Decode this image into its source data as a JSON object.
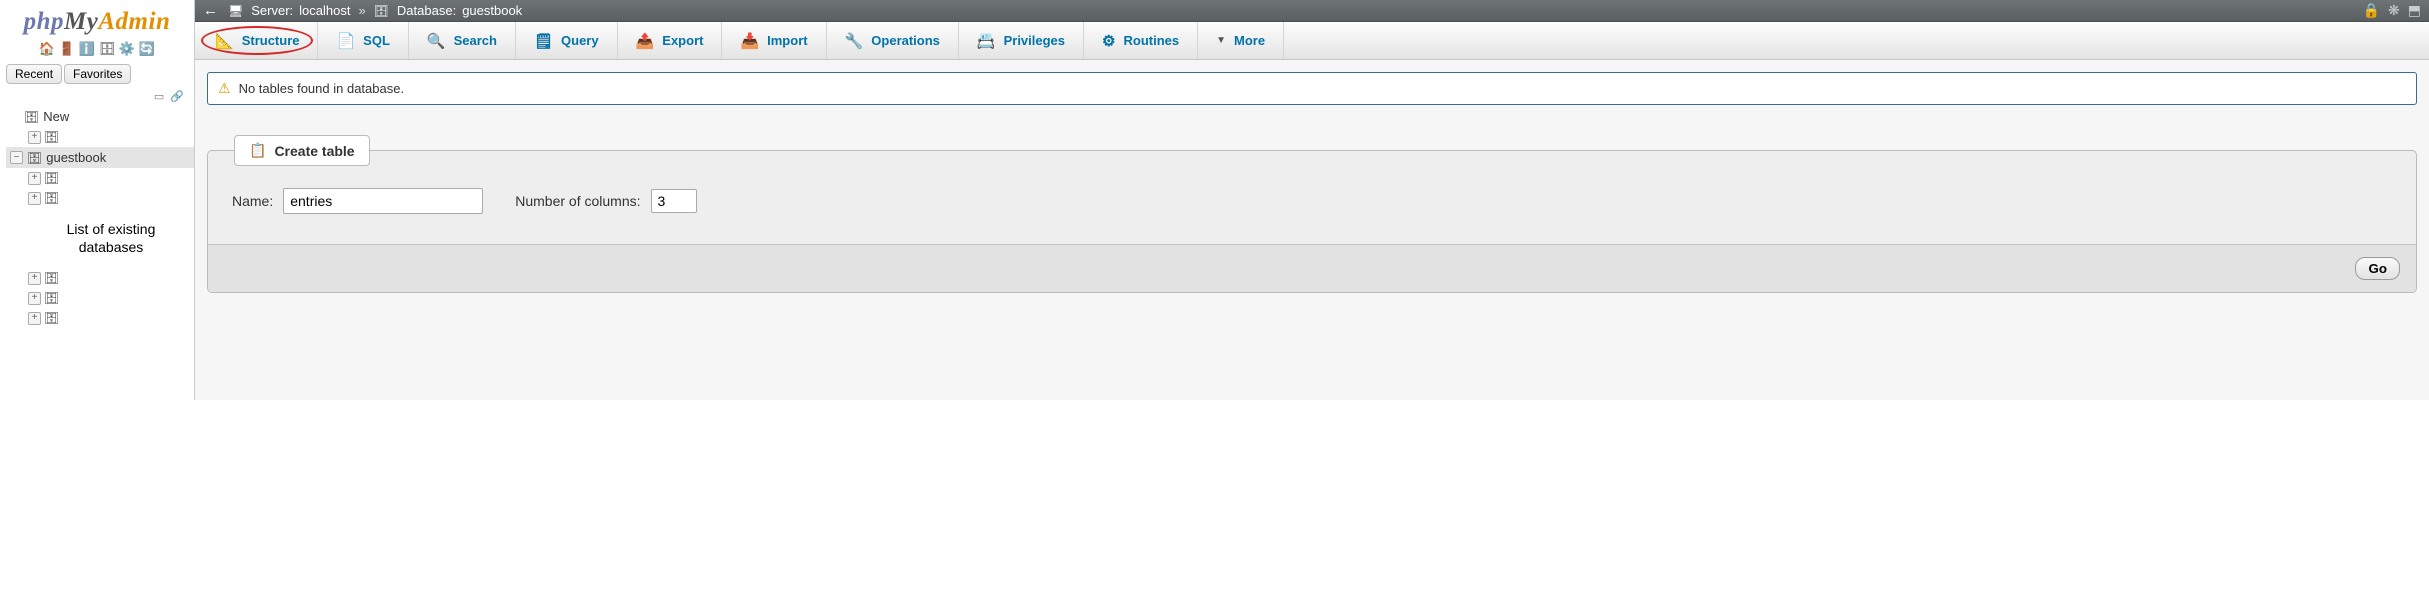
{
  "logo": {
    "p1": "php",
    "p2": "My",
    "p3": "Admin"
  },
  "sidebar": {
    "buttons": {
      "recent": "Recent",
      "favorites": "Favorites"
    },
    "tree": {
      "new": "New",
      "selected": "guestbook",
      "note": "List of existing databases"
    }
  },
  "breadcrumb": {
    "server_label": "Server:",
    "server_value": "localhost",
    "db_label": "Database:",
    "db_value": "guestbook"
  },
  "tabs": [
    {
      "id": "structure",
      "label": "Structure",
      "icon": "📐",
      "active": true
    },
    {
      "id": "sql",
      "label": "SQL",
      "icon": "📄"
    },
    {
      "id": "search",
      "label": "Search",
      "icon": "🔍"
    },
    {
      "id": "query",
      "label": "Query",
      "icon": "🗒"
    },
    {
      "id": "export",
      "label": "Export",
      "icon": "📤"
    },
    {
      "id": "import",
      "label": "Import",
      "icon": "📥"
    },
    {
      "id": "operations",
      "label": "Operations",
      "icon": "🔧"
    },
    {
      "id": "privileges",
      "label": "Privileges",
      "icon": "📇"
    },
    {
      "id": "routines",
      "label": "Routines",
      "icon": "⚙"
    },
    {
      "id": "more",
      "label": "More"
    }
  ],
  "notice": "No tables found in database.",
  "create": {
    "legend": "Create table",
    "name_label": "Name:",
    "name_value": "entries",
    "cols_label": "Number of columns:",
    "cols_value": "3",
    "go": "Go"
  }
}
